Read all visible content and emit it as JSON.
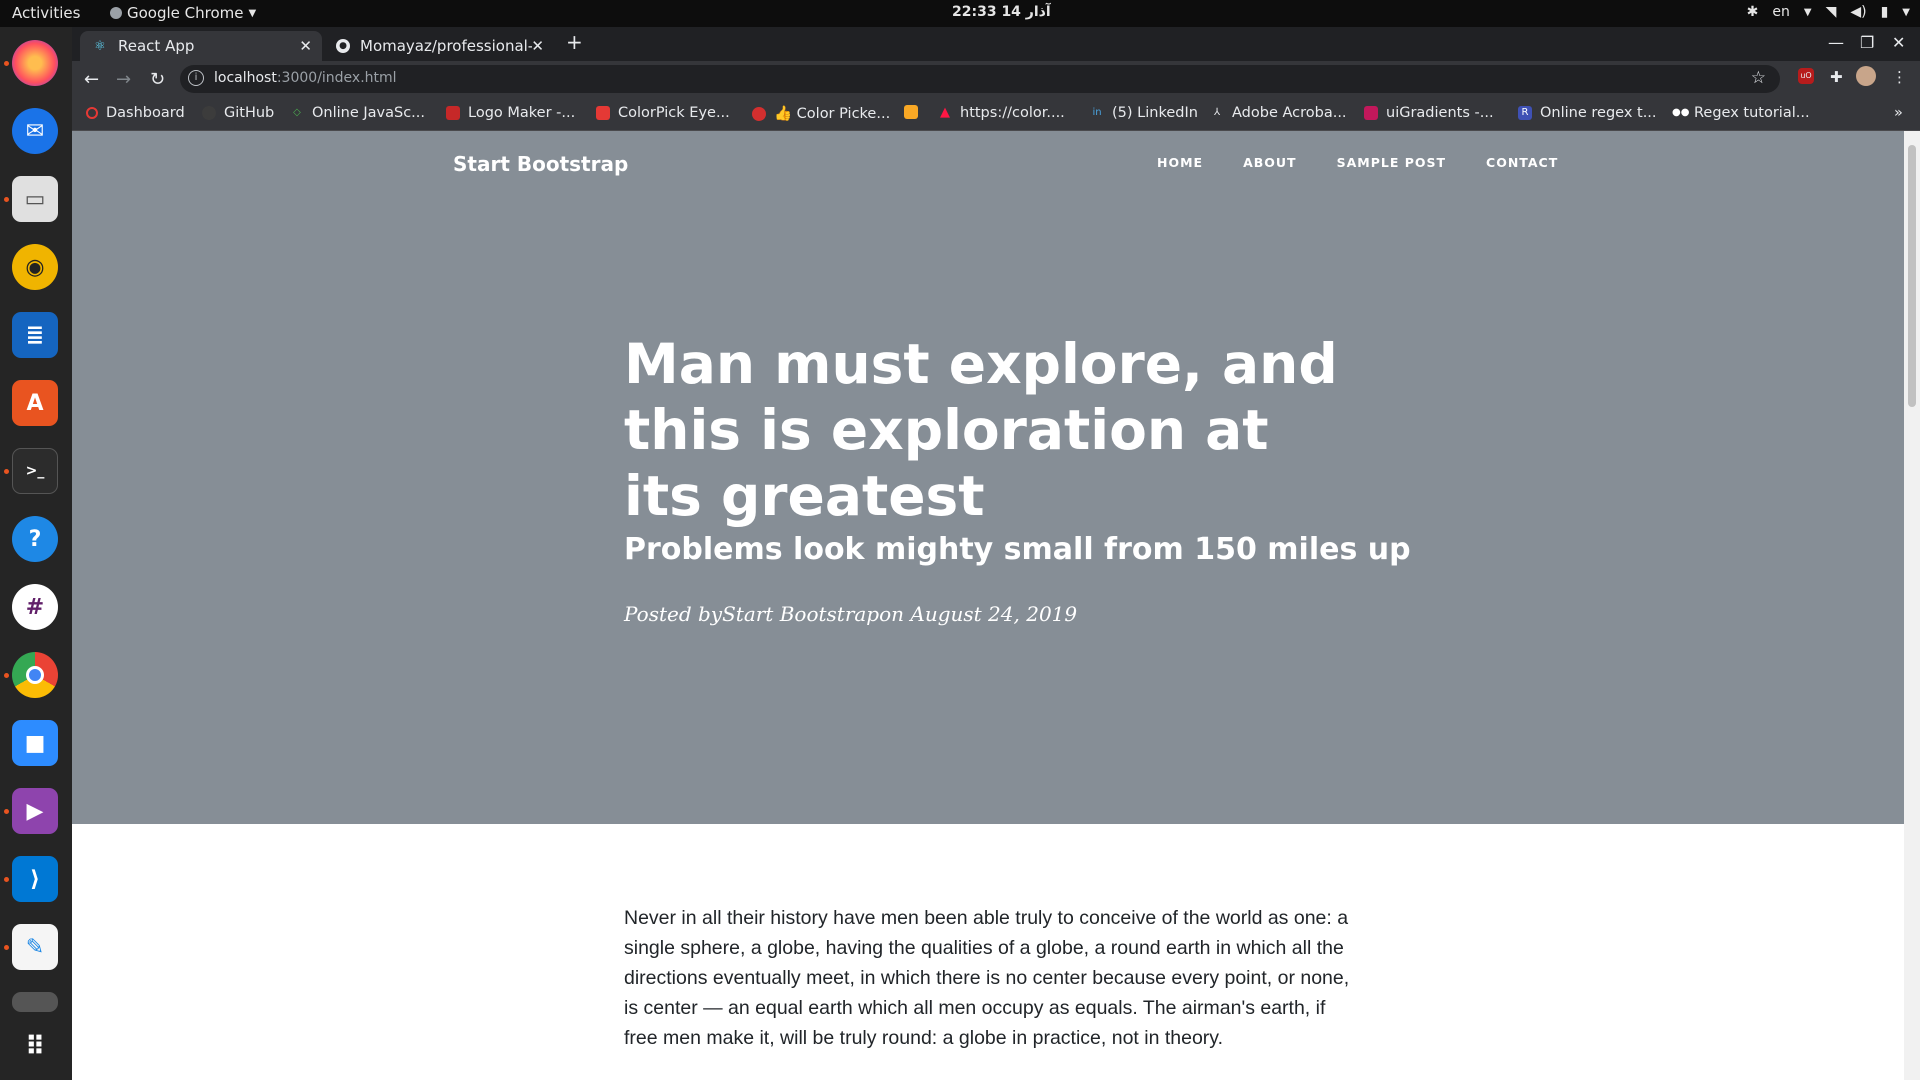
{
  "os": {
    "activities": "Activities",
    "app_menu": "Google Chrome",
    "clock": "22:33  14 آذار",
    "language": "en"
  },
  "dock": {
    "items": [
      "Firefox",
      "Thunderbird",
      "Files",
      "Rhythmbox",
      "LibreOffice Writer",
      "Ubuntu Software",
      "Terminal",
      "Help",
      "Slack",
      "Google Chrome",
      "Zoom",
      "Videos",
      "Visual Studio Code",
      "Text Editor",
      "Trash",
      "Show Applications"
    ]
  },
  "browser": {
    "tabs": [
      {
        "title": "React App",
        "active": true
      },
      {
        "title": "Momayaz/professional-bl",
        "active": false
      }
    ],
    "url_host": "localhost",
    "url_rest": ":3000/index.html",
    "bookmarks": [
      "Dashboard",
      "GitHub",
      "Online JavaSc...",
      "Logo Maker -...",
      "ColorPick Eye...",
      "👍 Color Picke...",
      "",
      "https://color....",
      "(5) LinkedIn",
      "Adobe Acroba...",
      "uiGradients -...",
      "Online regex t...",
      "Regex tutorial..."
    ],
    "bookmarks_overflow": "»"
  },
  "page": {
    "brand": "Start Bootstrap",
    "nav": [
      "HOME",
      "ABOUT",
      "SAMPLE POST",
      "CONTACT"
    ],
    "heading": "Man must explore, and this is exploration at its greatest",
    "subheading": "Problems look mighty small from 150 miles up",
    "meta": "Posted byStart Bootstrapon August 24, 2019",
    "paragraph": "Never in all their history have men been able truly to conceive of the world as one: a single sphere, a globe, having the qualities of a globe, a round earth in which all the directions eventually meet, in which there is no center because every point, or none, is center — an equal earth which all men occupy as equals. The airman's earth, if free men make it, will be truly round: a globe in practice, not in theory."
  },
  "colors": {
    "masthead": "#868e96",
    "text": "#212529"
  }
}
